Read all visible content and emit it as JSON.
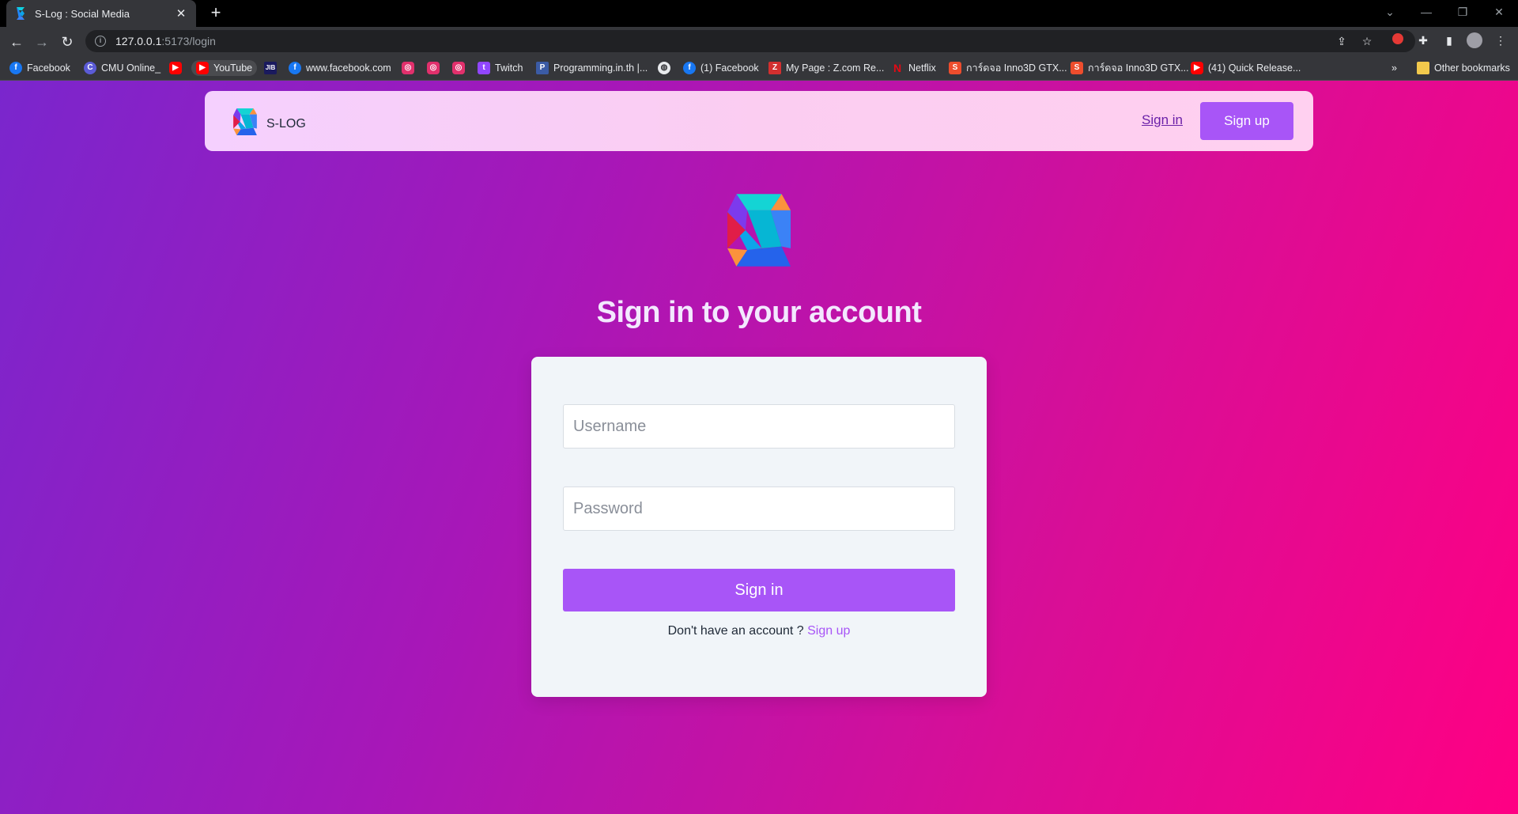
{
  "browser": {
    "tab_title": "S-Log : Social Media",
    "url_host": "127.0.0.1",
    "url_path": ":5173/login",
    "bookmarks": [
      {
        "label": "Facebook",
        "icon": "facebook-icon"
      },
      {
        "label": "CMU Online_",
        "icon": "cmu-icon"
      },
      {
        "label": "",
        "icon": "youtube-icon"
      },
      {
        "label": "YouTube",
        "icon": "youtube-icon"
      },
      {
        "label": "",
        "icon": "jib-icon"
      },
      {
        "label": "www.facebook.com",
        "icon": "facebook-icon"
      },
      {
        "label": "",
        "icon": "instagram-icon"
      },
      {
        "label": "",
        "icon": "instagram-icon"
      },
      {
        "label": "",
        "icon": "instagram-icon"
      },
      {
        "label": "Twitch",
        "icon": "twitch-icon"
      },
      {
        "label": "Programming.in.th |...",
        "icon": "programming-icon"
      },
      {
        "label": "",
        "icon": "globe-icon"
      },
      {
        "label": "(1) Facebook",
        "icon": "facebook-icon"
      },
      {
        "label": "My Page : Z.com Re...",
        "icon": "zcom-icon"
      },
      {
        "label": "Netflix",
        "icon": "netflix-icon"
      },
      {
        "label": "การ์ดจอ Inno3D GTX...",
        "icon": "shopee-icon"
      },
      {
        "label": "การ์ดจอ Inno3D GTX...",
        "icon": "shopee-icon"
      },
      {
        "label": "(41) Quick Release...",
        "icon": "youtube-icon"
      }
    ],
    "other_bookmarks": "Other bookmarks"
  },
  "navbar": {
    "brand": "S-LOG",
    "signin": "Sign in",
    "signup": "Sign up"
  },
  "login": {
    "heading": "Sign in to your account",
    "username_placeholder": "Username",
    "password_placeholder": "Password",
    "submit": "Sign in",
    "no_account": "Don't have an account ?",
    "signup_link": "Sign up"
  },
  "colors": {
    "accent": "#a855f7",
    "gradient_start": "#7a26cd",
    "gradient_end": "#ff0083"
  }
}
